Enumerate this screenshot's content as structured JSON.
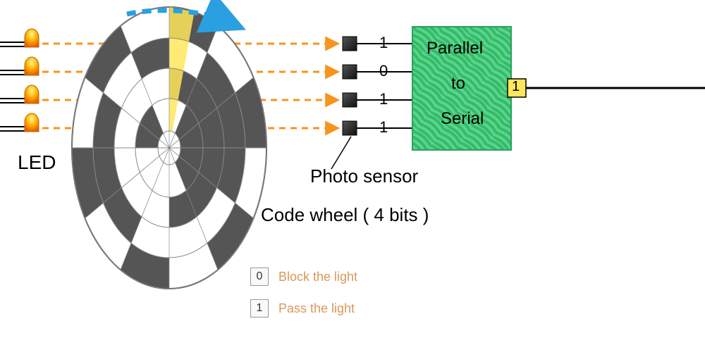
{
  "labels": {
    "led": "LED",
    "photo_sensor": "Photo sensor",
    "code_wheel": "Code wheel ( 4 bits )",
    "converter_line1": "Parallel",
    "converter_line2": "to",
    "converter_line3": "Serial"
  },
  "bits": [
    "1",
    "0",
    "1",
    "1"
  ],
  "output_bit": "1",
  "legend": {
    "block_val": "0",
    "block_text": "Block the light",
    "pass_val": "1",
    "pass_text": "Pass the light"
  },
  "chart_data": {
    "type": "diagram",
    "title": "Optical absolute encoder (4-bit Gray-code wheel) with parallel-to-serial converter",
    "leds": 4,
    "photo_sensors": 4,
    "bits": 4,
    "current_reading": [
      1,
      0,
      1,
      1
    ],
    "serial_output_current_bit": 1,
    "legend": {
      "0": "Block the light",
      "1": "Pass the light"
    },
    "rotation_indicator": "clockwise"
  }
}
